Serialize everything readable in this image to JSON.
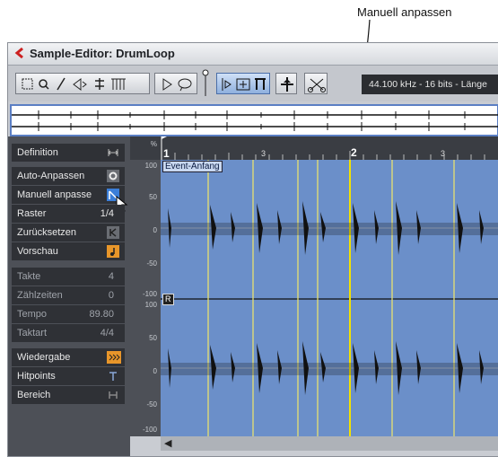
{
  "callout": {
    "text": "Manuell anpassen"
  },
  "window": {
    "title": "Sample-Editor: DrumLoop"
  },
  "toolbar": {
    "status": "44.100 kHz - 16 bits - Länge"
  },
  "ruler": {
    "left_marker": "1",
    "marks": [
      "1",
      "3",
      "2",
      "3"
    ]
  },
  "event_start_label": "Event-Anfang",
  "channel_marker": "R",
  "yaxis": [
    "%",
    "100",
    "50",
    "0",
    "-50",
    "-100",
    "100",
    "50",
    "0",
    "-50",
    "-100"
  ],
  "sidebar": {
    "definition": "Definition",
    "auto_adjust": "Auto-Anpassen",
    "manual_adjust": "Manuell anpasse",
    "grid_label": "Raster",
    "grid_value": "1/4",
    "reset": "Zurücksetzen",
    "preview": "Vorschau",
    "bars_label": "Takte",
    "bars_value": "4",
    "beats_label": "Zählzeiten",
    "beats_value": "0",
    "tempo_label": "Tempo",
    "tempo_value": "89.80",
    "meter_label": "Taktart",
    "meter_value": "4/4",
    "playback": "Wiedergabe",
    "hitpoints": "Hitpoints",
    "range": "Bereich"
  },
  "colors": {
    "waveform_bg": "#6b8fc9",
    "hitpoint_line": "#e8e070",
    "accent_orange": "#e8962a"
  }
}
